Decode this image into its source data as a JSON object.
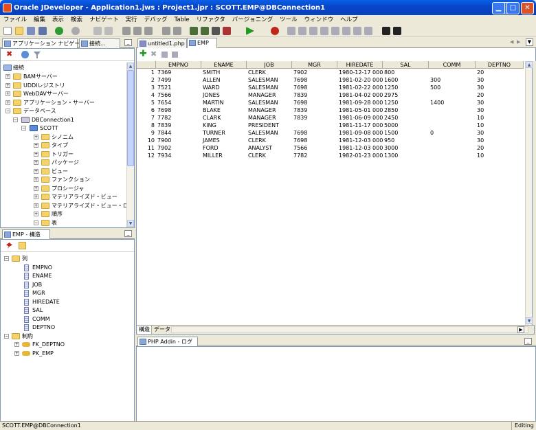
{
  "window": {
    "title": "Oracle JDeveloper - Application1.jws : Project1.jpr : SCOTT.EMP@DBConnection1"
  },
  "menu": [
    "ファイル",
    "編集",
    "表示",
    "検索",
    "ナビゲート",
    "実行",
    "デバッグ",
    "Table",
    "リファクタ",
    "バージョニング",
    "ツール",
    "ウィンドウ",
    "ヘルプ"
  ],
  "left_tabs": {
    "nav": "アプリケーション ナビゲータ",
    "conn": "接続..."
  },
  "conn_tree": {
    "root": "接続",
    "items": [
      "BAMサーバー",
      "UDDIレジストリ",
      "WebDAVサーバー",
      "アプリケーション・サーバー",
      "データベース"
    ],
    "db_conn": "DBConnection1",
    "schema": "SCOTT",
    "objects": [
      "シノニム",
      "タイプ",
      "トリガー",
      "パッケージ",
      "ビュー",
      "ファンクション",
      "プロシージャ",
      "マテリアライズド・ビュー",
      "マテリアライズド・ビュー・ログ",
      "順序",
      "表"
    ]
  },
  "structure": {
    "title": "EMP - 構造",
    "columns_label": "列",
    "columns": [
      "EMPNO",
      "ENAME",
      "JOB",
      "MGR",
      "HIREDATE",
      "SAL",
      "COMM",
      "DEPTNO"
    ],
    "constraints_label": "制約",
    "constraints": [
      "FK_DEPTNO",
      "PK_EMP"
    ]
  },
  "editor_tabs": {
    "php": "untitled1.php",
    "emp": "EMP"
  },
  "table": {
    "headers": [
      "EMPNO",
      "ENAME",
      "JOB",
      "MGR",
      "HIREDATE",
      "SAL",
      "COMM",
      "DEPTNO"
    ],
    "rows": [
      [
        "1",
        "7369",
        "SMITH",
        "CLERK",
        "7902",
        "1980-12-17 000...",
        "800",
        "",
        "20"
      ],
      [
        "2",
        "7499",
        "ALLEN",
        "SALESMAN",
        "7698",
        "1981-02-20 000...",
        "1600",
        "300",
        "30"
      ],
      [
        "3",
        "7521",
        "WARD",
        "SALESMAN",
        "7698",
        "1981-02-22 000...",
        "1250",
        "500",
        "30"
      ],
      [
        "4",
        "7566",
        "JONES",
        "MANAGER",
        "7839",
        "1981-04-02 000...",
        "2975",
        "",
        "20"
      ],
      [
        "5",
        "7654",
        "MARTIN",
        "SALESMAN",
        "7698",
        "1981-09-28 000...",
        "1250",
        "1400",
        "30"
      ],
      [
        "6",
        "7698",
        "BLAKE",
        "MANAGER",
        "7839",
        "1981-05-01 000...",
        "2850",
        "",
        "30"
      ],
      [
        "7",
        "7782",
        "CLARK",
        "MANAGER",
        "7839",
        "1981-06-09 000...",
        "2450",
        "",
        "10"
      ],
      [
        "8",
        "7839",
        "KING",
        "PRESIDENT",
        "",
        "1981-11-17 000...",
        "5000",
        "",
        "10"
      ],
      [
        "9",
        "7844",
        "TURNER",
        "SALESMAN",
        "7698",
        "1981-09-08 000...",
        "1500",
        "0",
        "30"
      ],
      [
        "10",
        "7900",
        "JAMES",
        "CLERK",
        "7698",
        "1981-12-03 000...",
        "950",
        "",
        "30"
      ],
      [
        "11",
        "7902",
        "FORD",
        "ANALYST",
        "7566",
        "1981-12-03 000...",
        "3000",
        "",
        "20"
      ],
      [
        "12",
        "7934",
        "MILLER",
        "CLERK",
        "7782",
        "1982-01-23 000...",
        "1300",
        "",
        "10"
      ]
    ]
  },
  "bottom_tabs": {
    "structure": "構造",
    "data": "データ"
  },
  "log": {
    "title": "PHP Addin - ログ"
  },
  "status": {
    "left": "SCOTT.EMP@DBConnection1",
    "right": "Editing"
  }
}
